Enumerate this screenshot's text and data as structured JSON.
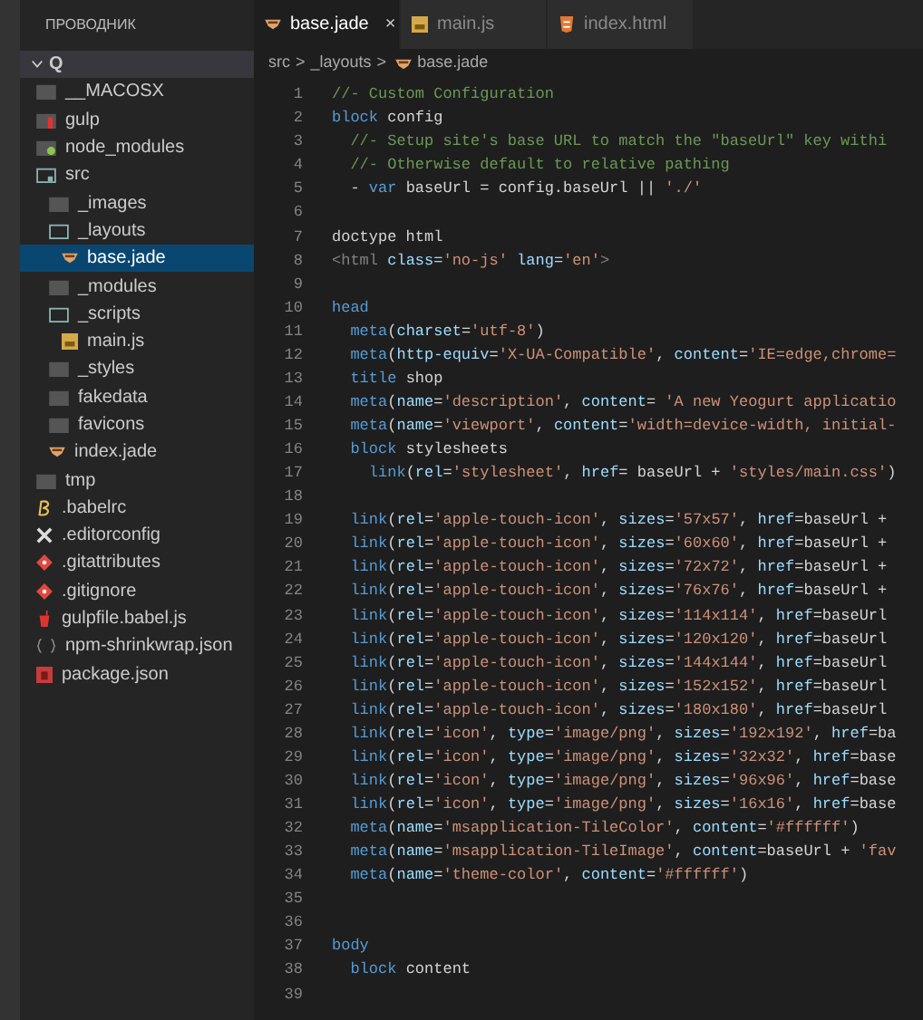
{
  "sidebar": {
    "title": "ПРОВОДНИК",
    "root": {
      "label": "Q",
      "expanded": true
    },
    "items": [
      {
        "label": "__MACOSX",
        "kind": "folder",
        "expanded": false,
        "selected": false
      },
      {
        "label": "gulp",
        "kind": "gulp-folder",
        "expanded": false,
        "selected": false
      },
      {
        "label": "node_modules",
        "kind": "node-folder",
        "expanded": false,
        "selected": false
      },
      {
        "label": "src",
        "kind": "src-folder",
        "expanded": true,
        "selected": false,
        "children": [
          {
            "label": "_images",
            "kind": "folder",
            "expanded": false,
            "selected": false
          },
          {
            "label": "_layouts",
            "kind": "folder",
            "expanded": true,
            "selected": false,
            "children": [
              {
                "label": "base.jade",
                "kind": "jade",
                "selected": true
              }
            ]
          },
          {
            "label": "_modules",
            "kind": "folder",
            "expanded": false,
            "selected": false
          },
          {
            "label": "_scripts",
            "kind": "folder",
            "expanded": true,
            "selected": false,
            "children": [
              {
                "label": "main.js",
                "kind": "js",
                "selected": false
              }
            ]
          },
          {
            "label": "_styles",
            "kind": "folder",
            "expanded": false,
            "selected": false
          },
          {
            "label": "fakedata",
            "kind": "folder",
            "expanded": false,
            "selected": false
          },
          {
            "label": "favicons",
            "kind": "folder",
            "expanded": false,
            "selected": false
          },
          {
            "label": "index.jade",
            "kind": "jade",
            "selected": false
          }
        ]
      },
      {
        "label": "tmp",
        "kind": "folder",
        "expanded": false,
        "selected": false
      },
      {
        "label": ".babelrc",
        "kind": "babel",
        "selected": false
      },
      {
        "label": ".editorconfig",
        "kind": "config",
        "selected": false
      },
      {
        "label": ".gitattributes",
        "kind": "git",
        "selected": false
      },
      {
        "label": ".gitignore",
        "kind": "git",
        "selected": false
      },
      {
        "label": "gulpfile.babel.js",
        "kind": "gulpfile",
        "selected": false
      },
      {
        "label": "npm-shrinkwrap.json",
        "kind": "braces",
        "selected": false
      },
      {
        "label": "package.json",
        "kind": "package",
        "selected": false
      }
    ]
  },
  "tabs": [
    {
      "label": "base.jade",
      "kind": "jade",
      "selected": true,
      "close": "×"
    },
    {
      "label": "main.js",
      "kind": "js",
      "selected": false
    },
    {
      "label": "index.html",
      "kind": "html",
      "selected": false
    }
  ],
  "breadcrumb": [
    {
      "label": "src",
      "kind": "text"
    },
    {
      "label": ">",
      "kind": "sep"
    },
    {
      "label": "_layouts",
      "kind": "text"
    },
    {
      "label": ">",
      "kind": "sep"
    },
    {
      "label": "base.jade",
      "kind": "jade"
    }
  ],
  "code": [
    {
      "n": "1",
      "tokens": [
        {
          "kind": "comment",
          "text": "//- Custom Configuration"
        }
      ]
    },
    {
      "n": "2",
      "tokens": [
        {
          "kind": "keyword",
          "text": "block"
        },
        {
          "kind": "plain",
          "text": " config"
        }
      ]
    },
    {
      "n": "3",
      "tokens": [
        {
          "kind": "comment",
          "text": "  //- Setup site's base URL to match the \"baseUrl\" key withi"
        }
      ]
    },
    {
      "n": "4",
      "tokens": [
        {
          "kind": "comment",
          "text": "  //- Otherwise default to relative pathing"
        }
      ]
    },
    {
      "n": "5",
      "tokens": [
        {
          "kind": "plain",
          "text": "  - "
        },
        {
          "kind": "keyword",
          "text": "var"
        },
        {
          "kind": "plain",
          "text": " baseUrl = config.baseUrl || "
        },
        {
          "kind": "string",
          "text": "'./'"
        }
      ]
    },
    {
      "n": "6"
    },
    {
      "n": "7",
      "tokens": [
        {
          "kind": "plain",
          "text": "doctype html"
        }
      ]
    },
    {
      "n": "8",
      "tokens": [
        {
          "kind": "tag",
          "text": "<html"
        },
        {
          "kind": "attr",
          "text": " class="
        },
        {
          "kind": "string",
          "text": "'no-js'"
        },
        {
          "kind": "attr",
          "text": " lang="
        },
        {
          "kind": "string",
          "text": "'en'"
        },
        {
          "kind": "tag",
          "text": ">"
        }
      ]
    },
    {
      "n": "9"
    },
    {
      "n": "10",
      "tokens": [
        {
          "kind": "keyword",
          "text": "head"
        }
      ]
    },
    {
      "n": "11",
      "tokens": [
        {
          "kind": "keyword",
          "text": "  meta"
        },
        {
          "kind": "plain",
          "text": "("
        },
        {
          "kind": "attr",
          "text": "charset"
        },
        {
          "kind": "plain",
          "text": "="
        },
        {
          "kind": "string",
          "text": "'utf-8'"
        },
        {
          "kind": "plain",
          "text": ")"
        }
      ]
    },
    {
      "n": "12",
      "tokens": [
        {
          "kind": "keyword",
          "text": "  meta"
        },
        {
          "kind": "plain",
          "text": "("
        },
        {
          "kind": "attr",
          "text": "http-equiv"
        },
        {
          "kind": "plain",
          "text": "="
        },
        {
          "kind": "string",
          "text": "'X-UA-Compatible'"
        },
        {
          "kind": "plain",
          "text": ", "
        },
        {
          "kind": "attr",
          "text": "content"
        },
        {
          "kind": "plain",
          "text": "="
        },
        {
          "kind": "string",
          "text": "'IE=edge,chrome="
        }
      ]
    },
    {
      "n": "13",
      "tokens": [
        {
          "kind": "keyword",
          "text": "  title"
        },
        {
          "kind": "plain",
          "text": " shop"
        }
      ]
    },
    {
      "n": "14",
      "tokens": [
        {
          "kind": "keyword",
          "text": "  meta"
        },
        {
          "kind": "plain",
          "text": "("
        },
        {
          "kind": "attr",
          "text": "name"
        },
        {
          "kind": "plain",
          "text": "="
        },
        {
          "kind": "string",
          "text": "'description'"
        },
        {
          "kind": "plain",
          "text": ", "
        },
        {
          "kind": "attr",
          "text": "content"
        },
        {
          "kind": "plain",
          "text": "= "
        },
        {
          "kind": "string",
          "text": "'A new Yeogurt applicatio"
        }
      ]
    },
    {
      "n": "15",
      "tokens": [
        {
          "kind": "keyword",
          "text": "  meta"
        },
        {
          "kind": "plain",
          "text": "("
        },
        {
          "kind": "attr",
          "text": "name"
        },
        {
          "kind": "plain",
          "text": "="
        },
        {
          "kind": "string",
          "text": "'viewport'"
        },
        {
          "kind": "plain",
          "text": ", "
        },
        {
          "kind": "attr",
          "text": "content"
        },
        {
          "kind": "plain",
          "text": "="
        },
        {
          "kind": "string",
          "text": "'width=device-width, initial-"
        }
      ]
    },
    {
      "n": "16",
      "tokens": [
        {
          "kind": "keyword",
          "text": "  block"
        },
        {
          "kind": "plain",
          "text": " stylesheets"
        }
      ]
    },
    {
      "n": "17",
      "tokens": [
        {
          "kind": "keyword",
          "text": "    link"
        },
        {
          "kind": "plain",
          "text": "("
        },
        {
          "kind": "attr",
          "text": "rel"
        },
        {
          "kind": "plain",
          "text": "="
        },
        {
          "kind": "string",
          "text": "'stylesheet'"
        },
        {
          "kind": "plain",
          "text": ", "
        },
        {
          "kind": "attr",
          "text": "href"
        },
        {
          "kind": "plain",
          "text": "= baseUrl + "
        },
        {
          "kind": "string",
          "text": "'styles/main.css'"
        },
        {
          "kind": "plain",
          "text": ")"
        }
      ]
    },
    {
      "n": "18"
    },
    {
      "n": "19",
      "tokens": [
        {
          "kind": "keyword",
          "text": "  link"
        },
        {
          "kind": "plain",
          "text": "("
        },
        {
          "kind": "attr",
          "text": "rel"
        },
        {
          "kind": "plain",
          "text": "="
        },
        {
          "kind": "string",
          "text": "'apple-touch-icon'"
        },
        {
          "kind": "plain",
          "text": ", "
        },
        {
          "kind": "attr",
          "text": "sizes"
        },
        {
          "kind": "plain",
          "text": "="
        },
        {
          "kind": "string",
          "text": "'57x57'"
        },
        {
          "kind": "plain",
          "text": ", "
        },
        {
          "kind": "attr",
          "text": "href"
        },
        {
          "kind": "plain",
          "text": "=baseUrl +"
        }
      ]
    },
    {
      "n": "20",
      "tokens": [
        {
          "kind": "keyword",
          "text": "  link"
        },
        {
          "kind": "plain",
          "text": "("
        },
        {
          "kind": "attr",
          "text": "rel"
        },
        {
          "kind": "plain",
          "text": "="
        },
        {
          "kind": "string",
          "text": "'apple-touch-icon'"
        },
        {
          "kind": "plain",
          "text": ", "
        },
        {
          "kind": "attr",
          "text": "sizes"
        },
        {
          "kind": "plain",
          "text": "="
        },
        {
          "kind": "string",
          "text": "'60x60'"
        },
        {
          "kind": "plain",
          "text": ", "
        },
        {
          "kind": "attr",
          "text": "href"
        },
        {
          "kind": "plain",
          "text": "=baseUrl +"
        }
      ]
    },
    {
      "n": "21",
      "tokens": [
        {
          "kind": "keyword",
          "text": "  link"
        },
        {
          "kind": "plain",
          "text": "("
        },
        {
          "kind": "attr",
          "text": "rel"
        },
        {
          "kind": "plain",
          "text": "="
        },
        {
          "kind": "string",
          "text": "'apple-touch-icon'"
        },
        {
          "kind": "plain",
          "text": ", "
        },
        {
          "kind": "attr",
          "text": "sizes"
        },
        {
          "kind": "plain",
          "text": "="
        },
        {
          "kind": "string",
          "text": "'72x72'"
        },
        {
          "kind": "plain",
          "text": ", "
        },
        {
          "kind": "attr",
          "text": "href"
        },
        {
          "kind": "plain",
          "text": "=baseUrl +"
        }
      ]
    },
    {
      "n": "22",
      "tokens": [
        {
          "kind": "keyword",
          "text": "  link"
        },
        {
          "kind": "plain",
          "text": "("
        },
        {
          "kind": "attr",
          "text": "rel"
        },
        {
          "kind": "plain",
          "text": "="
        },
        {
          "kind": "string",
          "text": "'apple-touch-icon'"
        },
        {
          "kind": "plain",
          "text": ", "
        },
        {
          "kind": "attr",
          "text": "sizes"
        },
        {
          "kind": "plain",
          "text": "="
        },
        {
          "kind": "string",
          "text": "'76x76'"
        },
        {
          "kind": "plain",
          "text": ", "
        },
        {
          "kind": "attr",
          "text": "href"
        },
        {
          "kind": "plain",
          "text": "=baseUrl +"
        }
      ]
    },
    {
      "n": "23",
      "tokens": [
        {
          "kind": "keyword",
          "text": "  link"
        },
        {
          "kind": "plain",
          "text": "("
        },
        {
          "kind": "attr",
          "text": "rel"
        },
        {
          "kind": "plain",
          "text": "="
        },
        {
          "kind": "string",
          "text": "'apple-touch-icon'"
        },
        {
          "kind": "plain",
          "text": ", "
        },
        {
          "kind": "attr",
          "text": "sizes"
        },
        {
          "kind": "plain",
          "text": "="
        },
        {
          "kind": "string",
          "text": "'114x114'"
        },
        {
          "kind": "plain",
          "text": ", "
        },
        {
          "kind": "attr",
          "text": "href"
        },
        {
          "kind": "plain",
          "text": "=baseUrl"
        }
      ]
    },
    {
      "n": "24",
      "tokens": [
        {
          "kind": "keyword",
          "text": "  link"
        },
        {
          "kind": "plain",
          "text": "("
        },
        {
          "kind": "attr",
          "text": "rel"
        },
        {
          "kind": "plain",
          "text": "="
        },
        {
          "kind": "string",
          "text": "'apple-touch-icon'"
        },
        {
          "kind": "plain",
          "text": ", "
        },
        {
          "kind": "attr",
          "text": "sizes"
        },
        {
          "kind": "plain",
          "text": "="
        },
        {
          "kind": "string",
          "text": "'120x120'"
        },
        {
          "kind": "plain",
          "text": ", "
        },
        {
          "kind": "attr",
          "text": "href"
        },
        {
          "kind": "plain",
          "text": "=baseUrl"
        }
      ]
    },
    {
      "n": "25",
      "tokens": [
        {
          "kind": "keyword",
          "text": "  link"
        },
        {
          "kind": "plain",
          "text": "("
        },
        {
          "kind": "attr",
          "text": "rel"
        },
        {
          "kind": "plain",
          "text": "="
        },
        {
          "kind": "string",
          "text": "'apple-touch-icon'"
        },
        {
          "kind": "plain",
          "text": ", "
        },
        {
          "kind": "attr",
          "text": "sizes"
        },
        {
          "kind": "plain",
          "text": "="
        },
        {
          "kind": "string",
          "text": "'144x144'"
        },
        {
          "kind": "plain",
          "text": ", "
        },
        {
          "kind": "attr",
          "text": "href"
        },
        {
          "kind": "plain",
          "text": "=baseUrl"
        }
      ]
    },
    {
      "n": "26",
      "tokens": [
        {
          "kind": "keyword",
          "text": "  link"
        },
        {
          "kind": "plain",
          "text": "("
        },
        {
          "kind": "attr",
          "text": "rel"
        },
        {
          "kind": "plain",
          "text": "="
        },
        {
          "kind": "string",
          "text": "'apple-touch-icon'"
        },
        {
          "kind": "plain",
          "text": ", "
        },
        {
          "kind": "attr",
          "text": "sizes"
        },
        {
          "kind": "plain",
          "text": "="
        },
        {
          "kind": "string",
          "text": "'152x152'"
        },
        {
          "kind": "plain",
          "text": ", "
        },
        {
          "kind": "attr",
          "text": "href"
        },
        {
          "kind": "plain",
          "text": "=baseUrl"
        }
      ]
    },
    {
      "n": "27",
      "tokens": [
        {
          "kind": "keyword",
          "text": "  link"
        },
        {
          "kind": "plain",
          "text": "("
        },
        {
          "kind": "attr",
          "text": "rel"
        },
        {
          "kind": "plain",
          "text": "="
        },
        {
          "kind": "string",
          "text": "'apple-touch-icon'"
        },
        {
          "kind": "plain",
          "text": ", "
        },
        {
          "kind": "attr",
          "text": "sizes"
        },
        {
          "kind": "plain",
          "text": "="
        },
        {
          "kind": "string",
          "text": "'180x180'"
        },
        {
          "kind": "plain",
          "text": ", "
        },
        {
          "kind": "attr",
          "text": "href"
        },
        {
          "kind": "plain",
          "text": "=baseUrl"
        }
      ]
    },
    {
      "n": "28",
      "tokens": [
        {
          "kind": "keyword",
          "text": "  link"
        },
        {
          "kind": "plain",
          "text": "("
        },
        {
          "kind": "attr",
          "text": "rel"
        },
        {
          "kind": "plain",
          "text": "="
        },
        {
          "kind": "string",
          "text": "'icon'"
        },
        {
          "kind": "plain",
          "text": ", "
        },
        {
          "kind": "attr",
          "text": "type"
        },
        {
          "kind": "plain",
          "text": "="
        },
        {
          "kind": "string",
          "text": "'image/png'"
        },
        {
          "kind": "plain",
          "text": ", "
        },
        {
          "kind": "attr",
          "text": "sizes"
        },
        {
          "kind": "plain",
          "text": "="
        },
        {
          "kind": "string",
          "text": "'192x192'"
        },
        {
          "kind": "plain",
          "text": ", "
        },
        {
          "kind": "attr",
          "text": "href"
        },
        {
          "kind": "plain",
          "text": "=ba"
        }
      ]
    },
    {
      "n": "29",
      "tokens": [
        {
          "kind": "keyword",
          "text": "  link"
        },
        {
          "kind": "plain",
          "text": "("
        },
        {
          "kind": "attr",
          "text": "rel"
        },
        {
          "kind": "plain",
          "text": "="
        },
        {
          "kind": "string",
          "text": "'icon'"
        },
        {
          "kind": "plain",
          "text": ", "
        },
        {
          "kind": "attr",
          "text": "type"
        },
        {
          "kind": "plain",
          "text": "="
        },
        {
          "kind": "string",
          "text": "'image/png'"
        },
        {
          "kind": "plain",
          "text": ", "
        },
        {
          "kind": "attr",
          "text": "sizes"
        },
        {
          "kind": "plain",
          "text": "="
        },
        {
          "kind": "string",
          "text": "'32x32'"
        },
        {
          "kind": "plain",
          "text": ", "
        },
        {
          "kind": "attr",
          "text": "href"
        },
        {
          "kind": "plain",
          "text": "=base"
        }
      ]
    },
    {
      "n": "30",
      "tokens": [
        {
          "kind": "keyword",
          "text": "  link"
        },
        {
          "kind": "plain",
          "text": "("
        },
        {
          "kind": "attr",
          "text": "rel"
        },
        {
          "kind": "plain",
          "text": "="
        },
        {
          "kind": "string",
          "text": "'icon'"
        },
        {
          "kind": "plain",
          "text": ", "
        },
        {
          "kind": "attr",
          "text": "type"
        },
        {
          "kind": "plain",
          "text": "="
        },
        {
          "kind": "string",
          "text": "'image/png'"
        },
        {
          "kind": "plain",
          "text": ", "
        },
        {
          "kind": "attr",
          "text": "sizes"
        },
        {
          "kind": "plain",
          "text": "="
        },
        {
          "kind": "string",
          "text": "'96x96'"
        },
        {
          "kind": "plain",
          "text": ", "
        },
        {
          "kind": "attr",
          "text": "href"
        },
        {
          "kind": "plain",
          "text": "=base"
        }
      ]
    },
    {
      "n": "31",
      "tokens": [
        {
          "kind": "keyword",
          "text": "  link"
        },
        {
          "kind": "plain",
          "text": "("
        },
        {
          "kind": "attr",
          "text": "rel"
        },
        {
          "kind": "plain",
          "text": "="
        },
        {
          "kind": "string",
          "text": "'icon'"
        },
        {
          "kind": "plain",
          "text": ", "
        },
        {
          "kind": "attr",
          "text": "type"
        },
        {
          "kind": "plain",
          "text": "="
        },
        {
          "kind": "string",
          "text": "'image/png'"
        },
        {
          "kind": "plain",
          "text": ", "
        },
        {
          "kind": "attr",
          "text": "sizes"
        },
        {
          "kind": "plain",
          "text": "="
        },
        {
          "kind": "string",
          "text": "'16x16'"
        },
        {
          "kind": "plain",
          "text": ", "
        },
        {
          "kind": "attr",
          "text": "href"
        },
        {
          "kind": "plain",
          "text": "=base"
        }
      ]
    },
    {
      "n": "32",
      "tokens": [
        {
          "kind": "keyword",
          "text": "  meta"
        },
        {
          "kind": "plain",
          "text": "("
        },
        {
          "kind": "attr",
          "text": "name"
        },
        {
          "kind": "plain",
          "text": "="
        },
        {
          "kind": "string",
          "text": "'msapplication-TileColor'"
        },
        {
          "kind": "plain",
          "text": ", "
        },
        {
          "kind": "attr",
          "text": "content"
        },
        {
          "kind": "plain",
          "text": "="
        },
        {
          "kind": "string",
          "text": "'#ffffff'"
        },
        {
          "kind": "plain",
          "text": ")"
        }
      ]
    },
    {
      "n": "33",
      "tokens": [
        {
          "kind": "keyword",
          "text": "  meta"
        },
        {
          "kind": "plain",
          "text": "("
        },
        {
          "kind": "attr",
          "text": "name"
        },
        {
          "kind": "plain",
          "text": "="
        },
        {
          "kind": "string",
          "text": "'msapplication-TileImage'"
        },
        {
          "kind": "plain",
          "text": ", "
        },
        {
          "kind": "attr",
          "text": "content"
        },
        {
          "kind": "plain",
          "text": "=baseUrl + "
        },
        {
          "kind": "string",
          "text": "'fav"
        }
      ]
    },
    {
      "n": "34",
      "tokens": [
        {
          "kind": "keyword",
          "text": "  meta"
        },
        {
          "kind": "plain",
          "text": "("
        },
        {
          "kind": "attr",
          "text": "name"
        },
        {
          "kind": "plain",
          "text": "="
        },
        {
          "kind": "string",
          "text": "'theme-color'"
        },
        {
          "kind": "plain",
          "text": ", "
        },
        {
          "kind": "attr",
          "text": "content"
        },
        {
          "kind": "plain",
          "text": "="
        },
        {
          "kind": "string",
          "text": "'#ffffff'"
        },
        {
          "kind": "plain",
          "text": ")"
        }
      ]
    },
    {
      "n": "35"
    },
    {
      "n": "36"
    },
    {
      "n": "37",
      "tokens": [
        {
          "kind": "keyword",
          "text": "body"
        }
      ]
    },
    {
      "n": "38",
      "tokens": [
        {
          "kind": "keyword",
          "text": "  block"
        },
        {
          "kind": "plain",
          "text": " content"
        }
      ]
    },
    {
      "n": "39"
    }
  ]
}
